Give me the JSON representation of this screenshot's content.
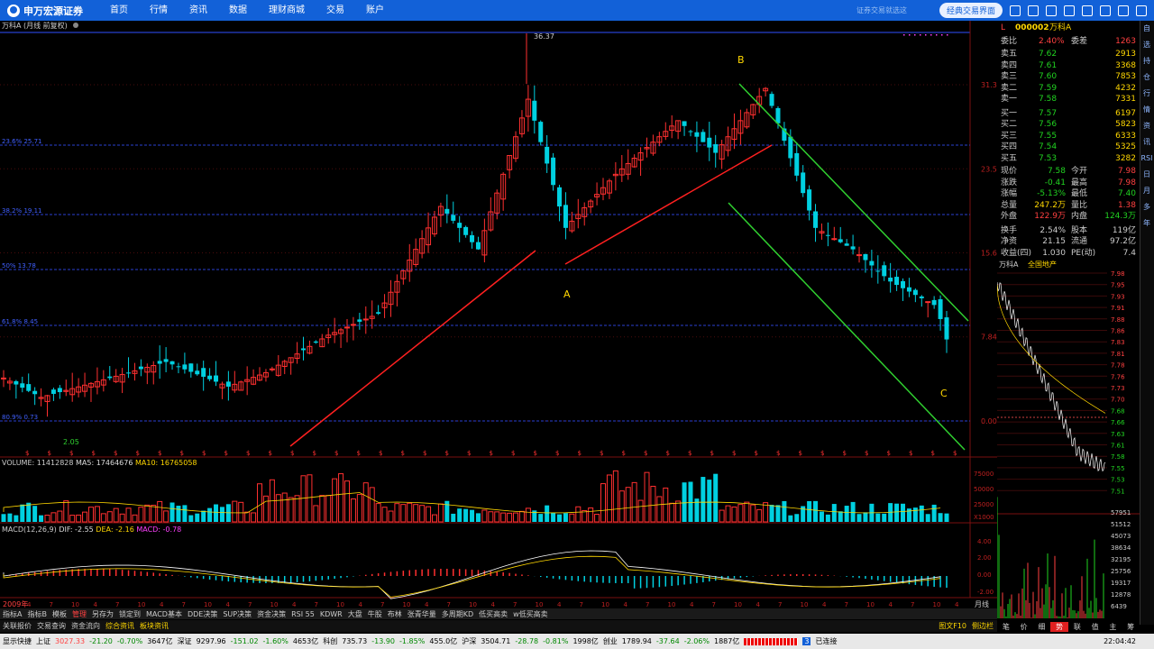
{
  "topbar": {
    "brand": "申万宏源证券",
    "nav": [
      "首页",
      "行情",
      "资讯",
      "数据",
      "理财商城",
      "交易",
      "账户"
    ],
    "slogan": "证券交易就选这",
    "classic": "经典交易界面"
  },
  "chart": {
    "header": "万科A (月线 前复权)",
    "peak": "36.37",
    "low": "2.05",
    "labels": {
      "A": "A",
      "B": "B",
      "C": "C"
    },
    "fib": [
      "23.6% 25.71",
      "38.2% 19.11",
      "50% 13.78",
      "61.8% 8.45",
      "80.9% 0.73"
    ],
    "yaxis": [
      "31.35",
      "23.51",
      "15.68",
      "7.84",
      "0.00"
    ],
    "volume_header": {
      "a": "VOLUME: 11412828",
      "b": "MA5: 17464676",
      "c": "MA10: 16765058"
    },
    "vol_axis": [
      "75000",
      "50000",
      "25000",
      "X1000"
    ],
    "macd_header": {
      "a": "MACD(12,26,9)",
      "b": "DIF: -2.55",
      "c": "DEA: -2.16",
      "d": "MACD: -0.78"
    },
    "macd_axis": [
      "4.00",
      "2.00",
      "0.00",
      "-2.00"
    ],
    "period": "月线",
    "year_label": "2009年",
    "xticks": [
      "4",
      "7",
      "10",
      "4",
      "7",
      "10",
      "4",
      "7",
      "10",
      "4",
      "7",
      "10",
      "4",
      "7",
      "10",
      "4",
      "7",
      "10",
      "4",
      "7",
      "10",
      "4",
      "7",
      "10",
      "4",
      "7",
      "10",
      "4",
      "7",
      "10",
      "4",
      "7",
      "10",
      "4",
      "7",
      "10",
      "4",
      "7",
      "10",
      "4",
      "7",
      "10",
      "4"
    ]
  },
  "quote": {
    "code": "000002",
    "name": "万科A",
    "wei_bi_label": "委比",
    "wei_bi": "2.40%",
    "wei_cha_label": "委差",
    "wei_cha": "1263",
    "sells": [
      {
        "label": "卖五",
        "price": "7.62",
        "vol": "2913"
      },
      {
        "label": "卖四",
        "price": "7.61",
        "vol": "3368"
      },
      {
        "label": "卖三",
        "price": "7.60",
        "vol": "7853"
      },
      {
        "label": "卖二",
        "price": "7.59",
        "vol": "4232"
      },
      {
        "label": "卖一",
        "price": "7.58",
        "vol": "7331"
      }
    ],
    "buys": [
      {
        "label": "买一",
        "price": "7.57",
        "vol": "6197"
      },
      {
        "label": "买二",
        "price": "7.56",
        "vol": "5823"
      },
      {
        "label": "买三",
        "price": "7.55",
        "vol": "6333"
      },
      {
        "label": "买四",
        "price": "7.54",
        "vol": "5325"
      },
      {
        "label": "买五",
        "price": "7.53",
        "vol": "3282"
      }
    ],
    "stats": [
      [
        "现价",
        "7.58",
        "今开",
        "7.98"
      ],
      [
        "涨跌",
        "-0.41",
        "最高",
        "7.98"
      ],
      [
        "涨幅",
        "-5.13%",
        "最低",
        "7.40"
      ],
      [
        "总量",
        "247.2万",
        "量比",
        "1.38"
      ],
      [
        "外盘",
        "122.9万",
        "内盘",
        "124.3万"
      ],
      [
        "换手",
        "2.54%",
        "股本",
        "119亿"
      ],
      [
        "净资",
        "21.15",
        "流通",
        "97.2亿"
      ],
      [
        "收益(四)",
        "1.030",
        "PE(动)",
        "7.4"
      ]
    ]
  },
  "intraday": {
    "name": "万科A",
    "sector": "全国地产",
    "prices": [
      "7.98",
      "7.95",
      "7.93",
      "7.91",
      "7.88",
      "7.86",
      "7.83",
      "7.81",
      "7.78",
      "7.76",
      "7.73",
      "7.70",
      "7.68",
      "7.66",
      "7.63",
      "7.61",
      "7.58",
      "7.55",
      "7.53",
      "7.51"
    ],
    "vols": [
      "57951",
      "51512",
      "45073",
      "38634",
      "32195",
      "25756",
      "19317",
      "12878",
      "6439"
    ]
  },
  "rtabs": [
    "笔",
    "价",
    "细",
    "势",
    "联",
    "值",
    "主",
    "筹"
  ],
  "side": [
    "自",
    "选",
    "持",
    "仓",
    "行",
    "情",
    "资",
    "讯",
    "RSI",
    "日",
    "月",
    "多",
    "年"
  ],
  "tabs1": [
    "指标A",
    "指标B",
    "模板",
    "管理",
    "另存为",
    "锁定到",
    "MACD基本",
    "DDE决策",
    "SUP决策",
    "资金决策",
    "RSI 55",
    "KDWR",
    "大盘",
    "牛股",
    "布林",
    "张青华量",
    "多周期KD",
    "低买高卖",
    "w低买高卖"
  ],
  "tabs2": [
    "关联报价",
    "交易查询",
    "资金流向",
    "综合资讯",
    "板块资讯"
  ],
  "tabs2_right": [
    "图文F10",
    "侧边栏"
  ],
  "status": {
    "quick": "显示快捷",
    "sh_label": "上证",
    "sh": "3027.33",
    "sh_chg": "-21.20",
    "sh_pct": "-0.70%",
    "sh_amt": "3647亿",
    "sz_label": "深证",
    "sz": "9297.96",
    "sz_chg": "-151.02",
    "sz_pct": "-1.60%",
    "sz_amt": "4653亿",
    "kc_label": "科创",
    "kc": "735.73",
    "kc_chg": "-13.90",
    "kc_pct": "-1.85%",
    "kc_amt": "455.0亿",
    "hs_label": "沪深",
    "hs": "3504.71",
    "hs_chg": "-28.78",
    "hs_pct": "-0.81%",
    "hs_amt": "1998亿",
    "cy_label": "创业",
    "cy": "1789.94",
    "cy_chg": "-37.64",
    "cy_pct": "-2.06%",
    "cy_amt": "1887亿",
    "conn": "已连接",
    "time": "22:04:42"
  },
  "colors": {
    "up": "#ff3030",
    "down": "#00d0e0",
    "accent": "#1261d8",
    "fib": "#3050ff",
    "trend_red": "#ff2020",
    "channel": "#30d030"
  }
}
